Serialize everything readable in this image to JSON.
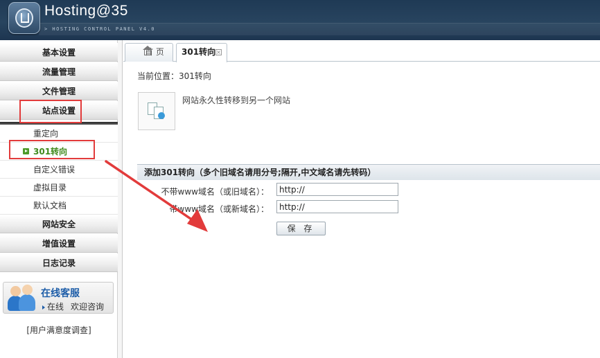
{
  "header": {
    "title": "Hosting@35",
    "subtitle": "> HOSTING CONTROL PANEL V4.0"
  },
  "sidebar": {
    "menu": [
      {
        "label": "基本设置"
      },
      {
        "label": "流量管理"
      },
      {
        "label": "文件管理"
      },
      {
        "label": "站点设置"
      }
    ],
    "sub_items": [
      {
        "label": "重定向"
      },
      {
        "label": "301转向"
      },
      {
        "label": "自定义错误"
      },
      {
        "label": "虚拟目录"
      },
      {
        "label": "默认文档"
      }
    ],
    "menu_lower": [
      {
        "label": "网站安全"
      },
      {
        "label": "增值设置"
      },
      {
        "label": "日志记录"
      }
    ],
    "customer_service": {
      "title": "在线客服",
      "status": "在线",
      "action": "欢迎咨询"
    },
    "survey": "[用户满意度调查]"
  },
  "tabs": [
    {
      "label": "首 页",
      "icon": "home-icon"
    },
    {
      "label": "301转向",
      "icon": "close-icon"
    }
  ],
  "main": {
    "breadcrumb": "当前位置：301转向",
    "description": "网站永久性转移到另一个网站",
    "form_title": "添加301转向（多个旧域名请用分号;隔开,中文域名请先转码）",
    "fields": [
      {
        "label": "不带www域名（或旧域名）：",
        "value": "http://"
      },
      {
        "label": "带www域名（或新域名）：",
        "value": "http://"
      }
    ],
    "save_label": "保 存"
  },
  "colors": {
    "header_bg": "#28445f",
    "active_green": "#3f8a1c",
    "highlight_red": "#e23b3b"
  }
}
